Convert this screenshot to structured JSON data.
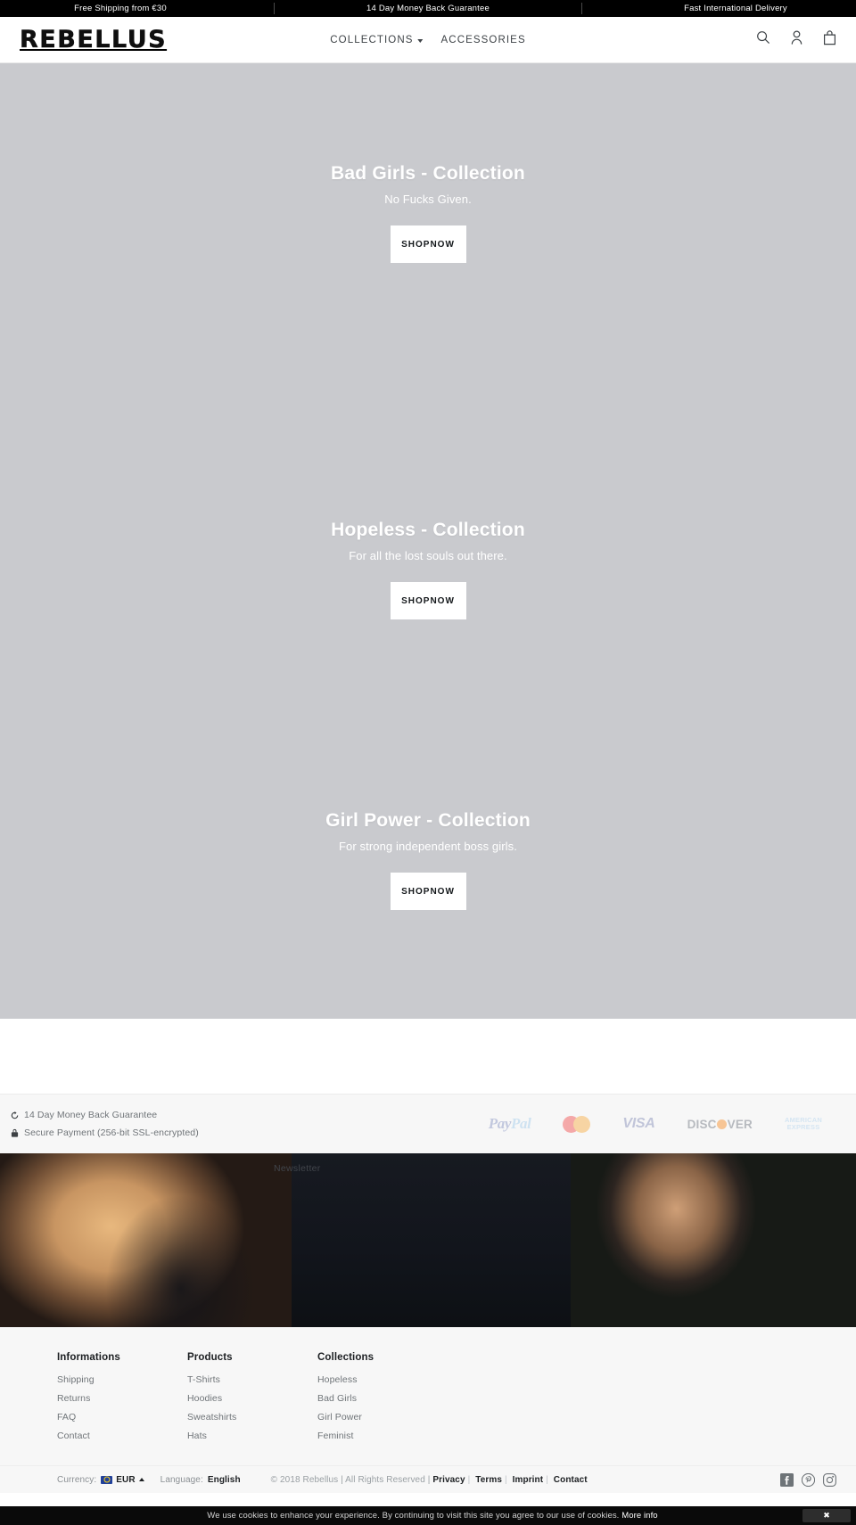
{
  "announcement": {
    "items": [
      "Free Shipping from €30",
      "14 Day Money Back Guarantee",
      "Fast International Delivery"
    ]
  },
  "header": {
    "logo": "REBELLUS",
    "nav": [
      {
        "label": "COLLECTIONS",
        "has_dropdown": true
      },
      {
        "label": "ACCESSORIES",
        "has_dropdown": false
      }
    ],
    "icons": [
      "search-icon",
      "account-icon",
      "cart-icon"
    ]
  },
  "heroes": [
    {
      "title": "Bad Girls - Collection",
      "subtitle": "No Fucks Given.",
      "button_line1": "SHOP",
      "button_line2": "NOW"
    },
    {
      "title": "Hopeless - Collection",
      "subtitle": "For all the lost souls out there.",
      "button_line1": "SHOP",
      "button_line2": "NOW"
    },
    {
      "title": "Girl Power - Collection",
      "subtitle": "For strong independent boss girls.",
      "button_line1": "SHOP",
      "button_line2": "NOW"
    }
  ],
  "trust": {
    "guarantee": "14 Day Money Back Guarantee",
    "secure": "Secure Payment (256-bit SSL-encrypted)",
    "payments": [
      {
        "name": "paypal",
        "part1": "Pay",
        "part2": "Pal"
      },
      {
        "name": "mastercard",
        "label": ""
      },
      {
        "name": "visa",
        "label": "VISA"
      },
      {
        "name": "discover",
        "pre": "DISC",
        "post": "VER"
      },
      {
        "name": "american-express",
        "line1": "AMERICAN",
        "line2": "EXPRESS"
      }
    ]
  },
  "newsletter": {
    "label": "Newsletter"
  },
  "footer": {
    "columns": [
      {
        "title": "Informations",
        "links": [
          "Shipping",
          "Returns",
          "FAQ",
          "Contact"
        ]
      },
      {
        "title": "Products",
        "links": [
          "T-Shirts",
          "Hoodies",
          "Sweatshirts",
          "Hats"
        ]
      },
      {
        "title": "Collections",
        "links": [
          "Hopeless",
          "Bad Girls",
          "Girl Power",
          "Feminist"
        ]
      }
    ],
    "bottom": {
      "currency_label": "Currency:",
      "currency_value": "EUR",
      "language_label": "Language:",
      "language_value": "English",
      "copyright": "© 2018 Rebellus | All Rights Reserved |",
      "legal_links": [
        "Privacy",
        "Terms",
        "Imprint",
        "Contact"
      ],
      "socials": [
        "facebook-icon",
        "pinterest-icon",
        "instagram-icon"
      ]
    }
  },
  "cookie": {
    "message": "We use cookies to enhance your experience. By continuing to visit this site you agree to our use of cookies.",
    "link": "More info",
    "close": "✖"
  },
  "colors": {
    "announce_bg": "#000000",
    "hero_placeholder": "#c9cace",
    "footer_bg": "#f7f7f7",
    "text_muted": "#6f7478"
  }
}
